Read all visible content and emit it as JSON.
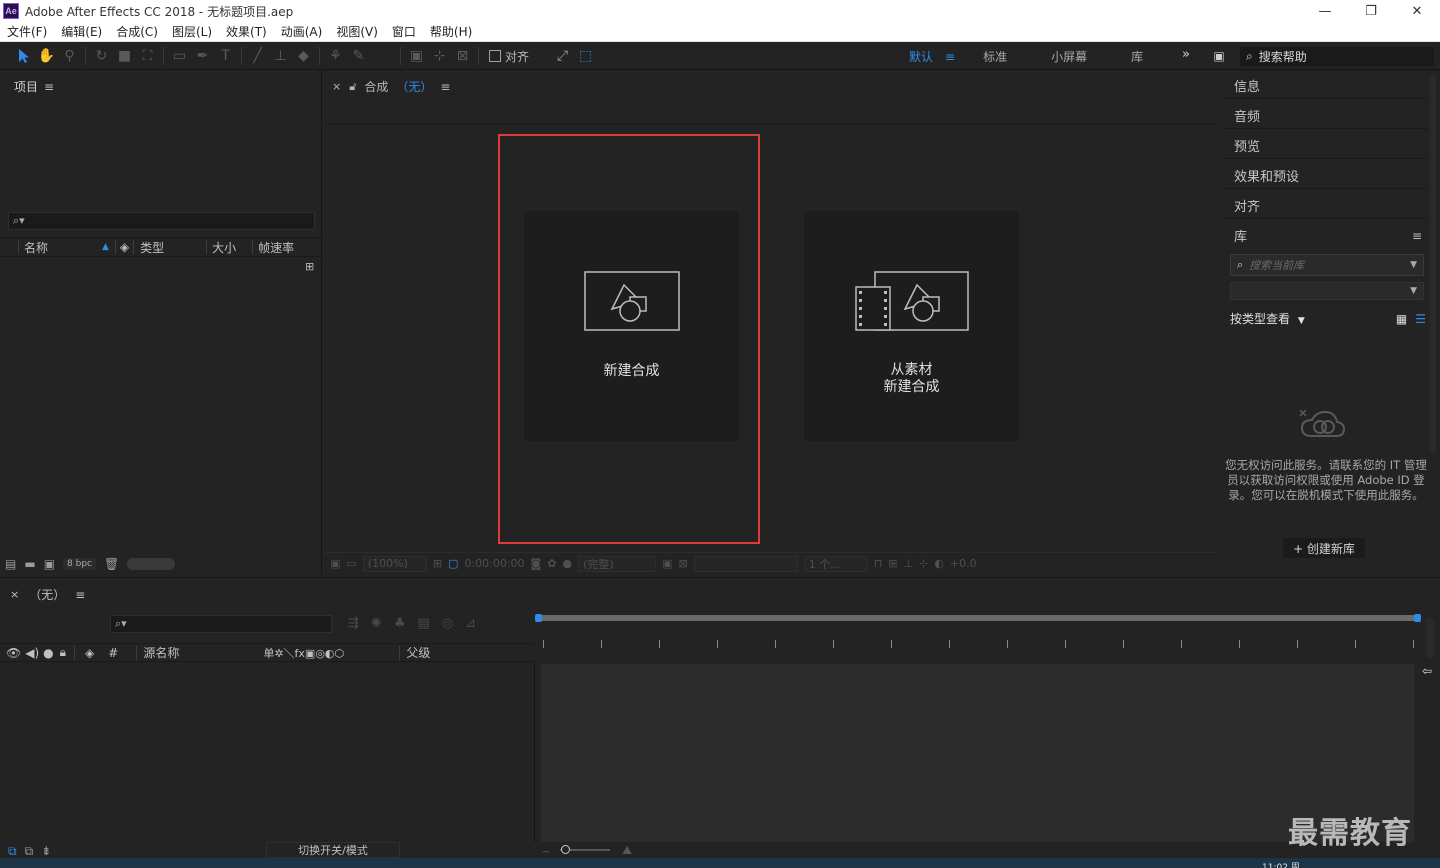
{
  "window": {
    "title": "Adobe After Effects CC 2018 - 无标题项目.aep",
    "app_icon": "Ae",
    "buttons": [
      "—",
      "❐",
      "✕"
    ]
  },
  "menu": [
    "文件(F)",
    "编辑(E)",
    "合成(C)",
    "图层(L)",
    "效果(T)",
    "动画(A)",
    "视图(V)",
    "窗口",
    "帮助(H)"
  ],
  "toolbar": {
    "align_label": "对齐",
    "workspaces": [
      "默认",
      "≡",
      "标准",
      "小屏幕",
      "库"
    ],
    "more": "»",
    "search_help": "搜索帮助"
  },
  "project": {
    "title": "项目",
    "menu": "≡",
    "search_glyph": "⌕▾",
    "columns": [
      "名称",
      "类型",
      "大小",
      "帧速率"
    ],
    "bpc": "8 bpc"
  },
  "composition": {
    "tab_close": "×",
    "tab_title": "合成",
    "tab_target": "（无）",
    "menu": "≡",
    "cards": [
      {
        "label_line1": "新建合成",
        "label_line2": ""
      },
      {
        "label_line1": "从素材",
        "label_line2": "新建合成"
      }
    ],
    "footer": {
      "zoom": "(100%)",
      "timecode": "0:00:00:00",
      "quality": "(完整)",
      "views": "1 个...",
      "exposure": "+0.0"
    }
  },
  "right_panels": {
    "items": [
      "信息",
      "音频",
      "预览",
      "效果和预设",
      "对齐"
    ],
    "library": {
      "title": "库",
      "menu": "≡",
      "search_placeholder": "搜索当前库",
      "view_by": "按类型查看",
      "message": "您无权访问此服务。请联系您的 IT 管理员以获取访问权限或使用 Adobe ID 登录。您可以在脱机模式下使用此服务。",
      "create_button": "+ 创建新库"
    }
  },
  "timeline": {
    "close": "×",
    "title": "（无）",
    "menu": "≡",
    "search_glyph": "⌕▾",
    "columns": {
      "hash": "#",
      "source_name": "源名称",
      "switches": "单✲＼fx▣◎◐⬡",
      "parent": "父级"
    },
    "toggle_label": "切换开关/模式"
  },
  "watermark": "最需教育",
  "tray_time": "11:02 周",
  "colors": {
    "accent_blue": "#2d8ceb",
    "highlight_red": "#e03b3b",
    "panel_bg": "#232323"
  }
}
